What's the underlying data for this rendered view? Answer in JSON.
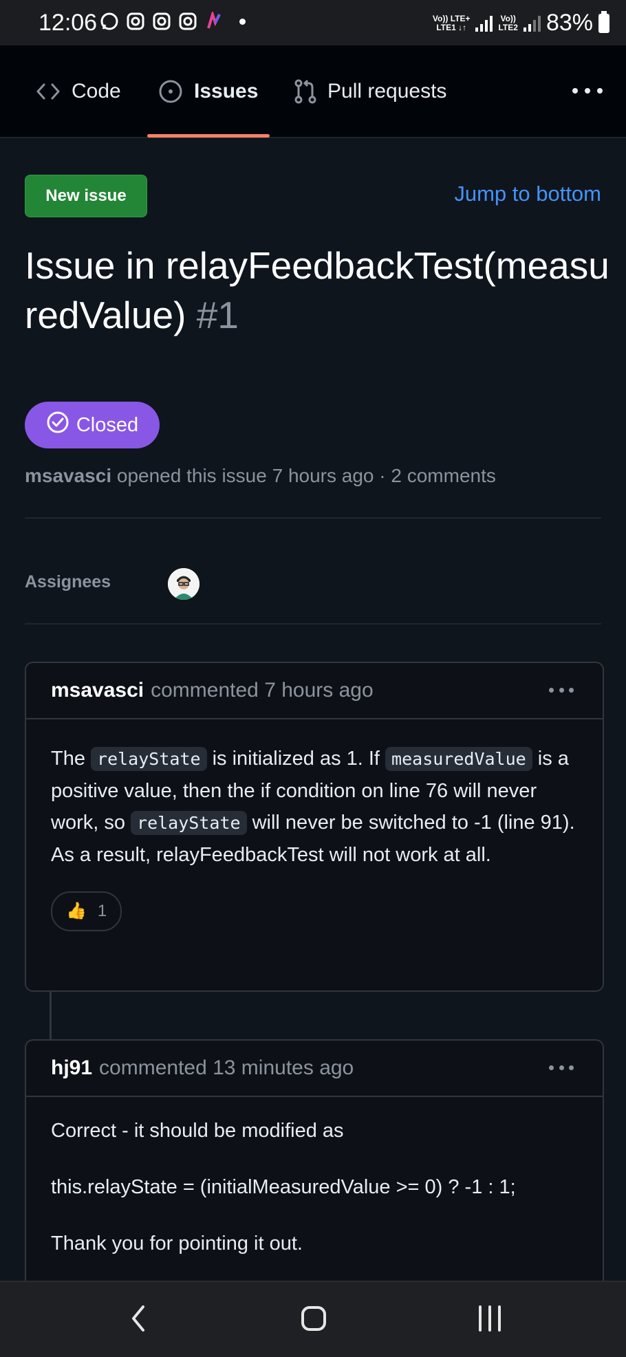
{
  "status_bar": {
    "time": "12:06",
    "network_1": "Vo)) LTE+",
    "network_1_sub": "LTE1 ↓↑",
    "network_2": "Vo))",
    "network_2_sub": "LTE2",
    "battery": "83%"
  },
  "tabs": {
    "code": "Code",
    "issues": "Issues",
    "pull_requests": "Pull requests"
  },
  "actions": {
    "new_issue": "New issue",
    "jump_to_bottom": "Jump to bottom"
  },
  "issue": {
    "title": "Issue in relayFeedbackTest(measuredValue)",
    "number": "#1",
    "state": "Closed",
    "author": "msavasci",
    "meta_text": "opened this issue 7 hours ago · 2 comments"
  },
  "assignees": {
    "label": "Assignees"
  },
  "comments": [
    {
      "author": "msavasci",
      "time_text": "commented 7 hours ago",
      "body": {
        "t1": "The ",
        "c1": "relayState",
        "t2": " is initialized as 1. If ",
        "c2": "measuredValue",
        "t3": " is a positive value, then the if condition on line 76 will never work, so ",
        "c3": "relayState",
        "t4": " will never be switched to -1 (line 91). As a result, relayFeedbackTest will not work at all."
      },
      "reaction_emoji": "👍",
      "reaction_count": "1"
    },
    {
      "author": "hj91",
      "time_text": "commented 13 minutes ago",
      "paragraphs": [
        "Correct - it should be modified as",
        "this.relayState = (initialMeasuredValue >= 0) ? -1 : 1;",
        "Thank you for pointing it out."
      ]
    }
  ],
  "colors": {
    "closed_badge": "#8957e5",
    "new_issue_button": "#238636",
    "link": "#4493f8",
    "active_tab_underline": "#f78166"
  },
  "icons": [
    "whatsapp-icon",
    "instagram-icon",
    "instagram-icon",
    "instagram-icon",
    "app-icon",
    "code-icon",
    "issue-icon",
    "pull-request-icon",
    "more-icon",
    "check-circle-icon",
    "back-icon",
    "home-icon",
    "recents-icon"
  ]
}
